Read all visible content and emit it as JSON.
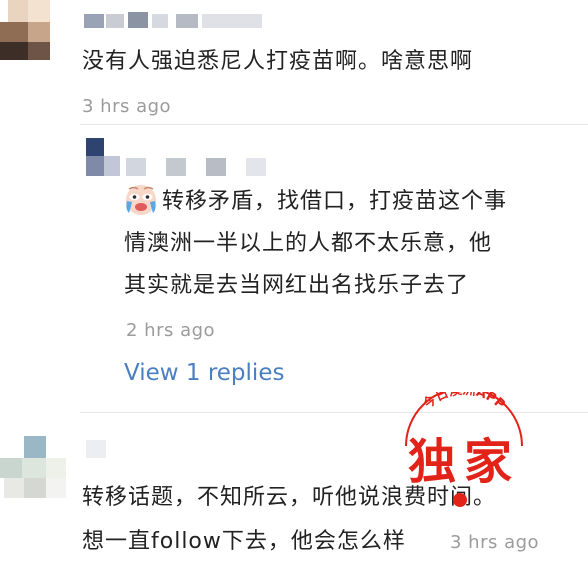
{
  "comment1": {
    "text": "没有人强迫悉尼人打疫苗啊。啥意思啊",
    "time": "3 hrs ago"
  },
  "reply1": {
    "text_lines": [
      "转移矛盾，找借口，打疫苗这个事",
      "情澳洲一半以上的人都不太乐意，他",
      "其实就是去当网红出名找乐子去了"
    ],
    "emoji": "crying-face",
    "time": "2 hrs ago",
    "view_replies": "View 1 replies"
  },
  "comment2": {
    "text_lines": [
      "转移话题，不知所云，听他说浪费时间。",
      "想一直follow下去，他会怎么样"
    ],
    "time": "3 hrs ago"
  },
  "watermark": {
    "arc_text": "今日澳洲APP",
    "main_text": "独家",
    "color": "#e2231a"
  }
}
